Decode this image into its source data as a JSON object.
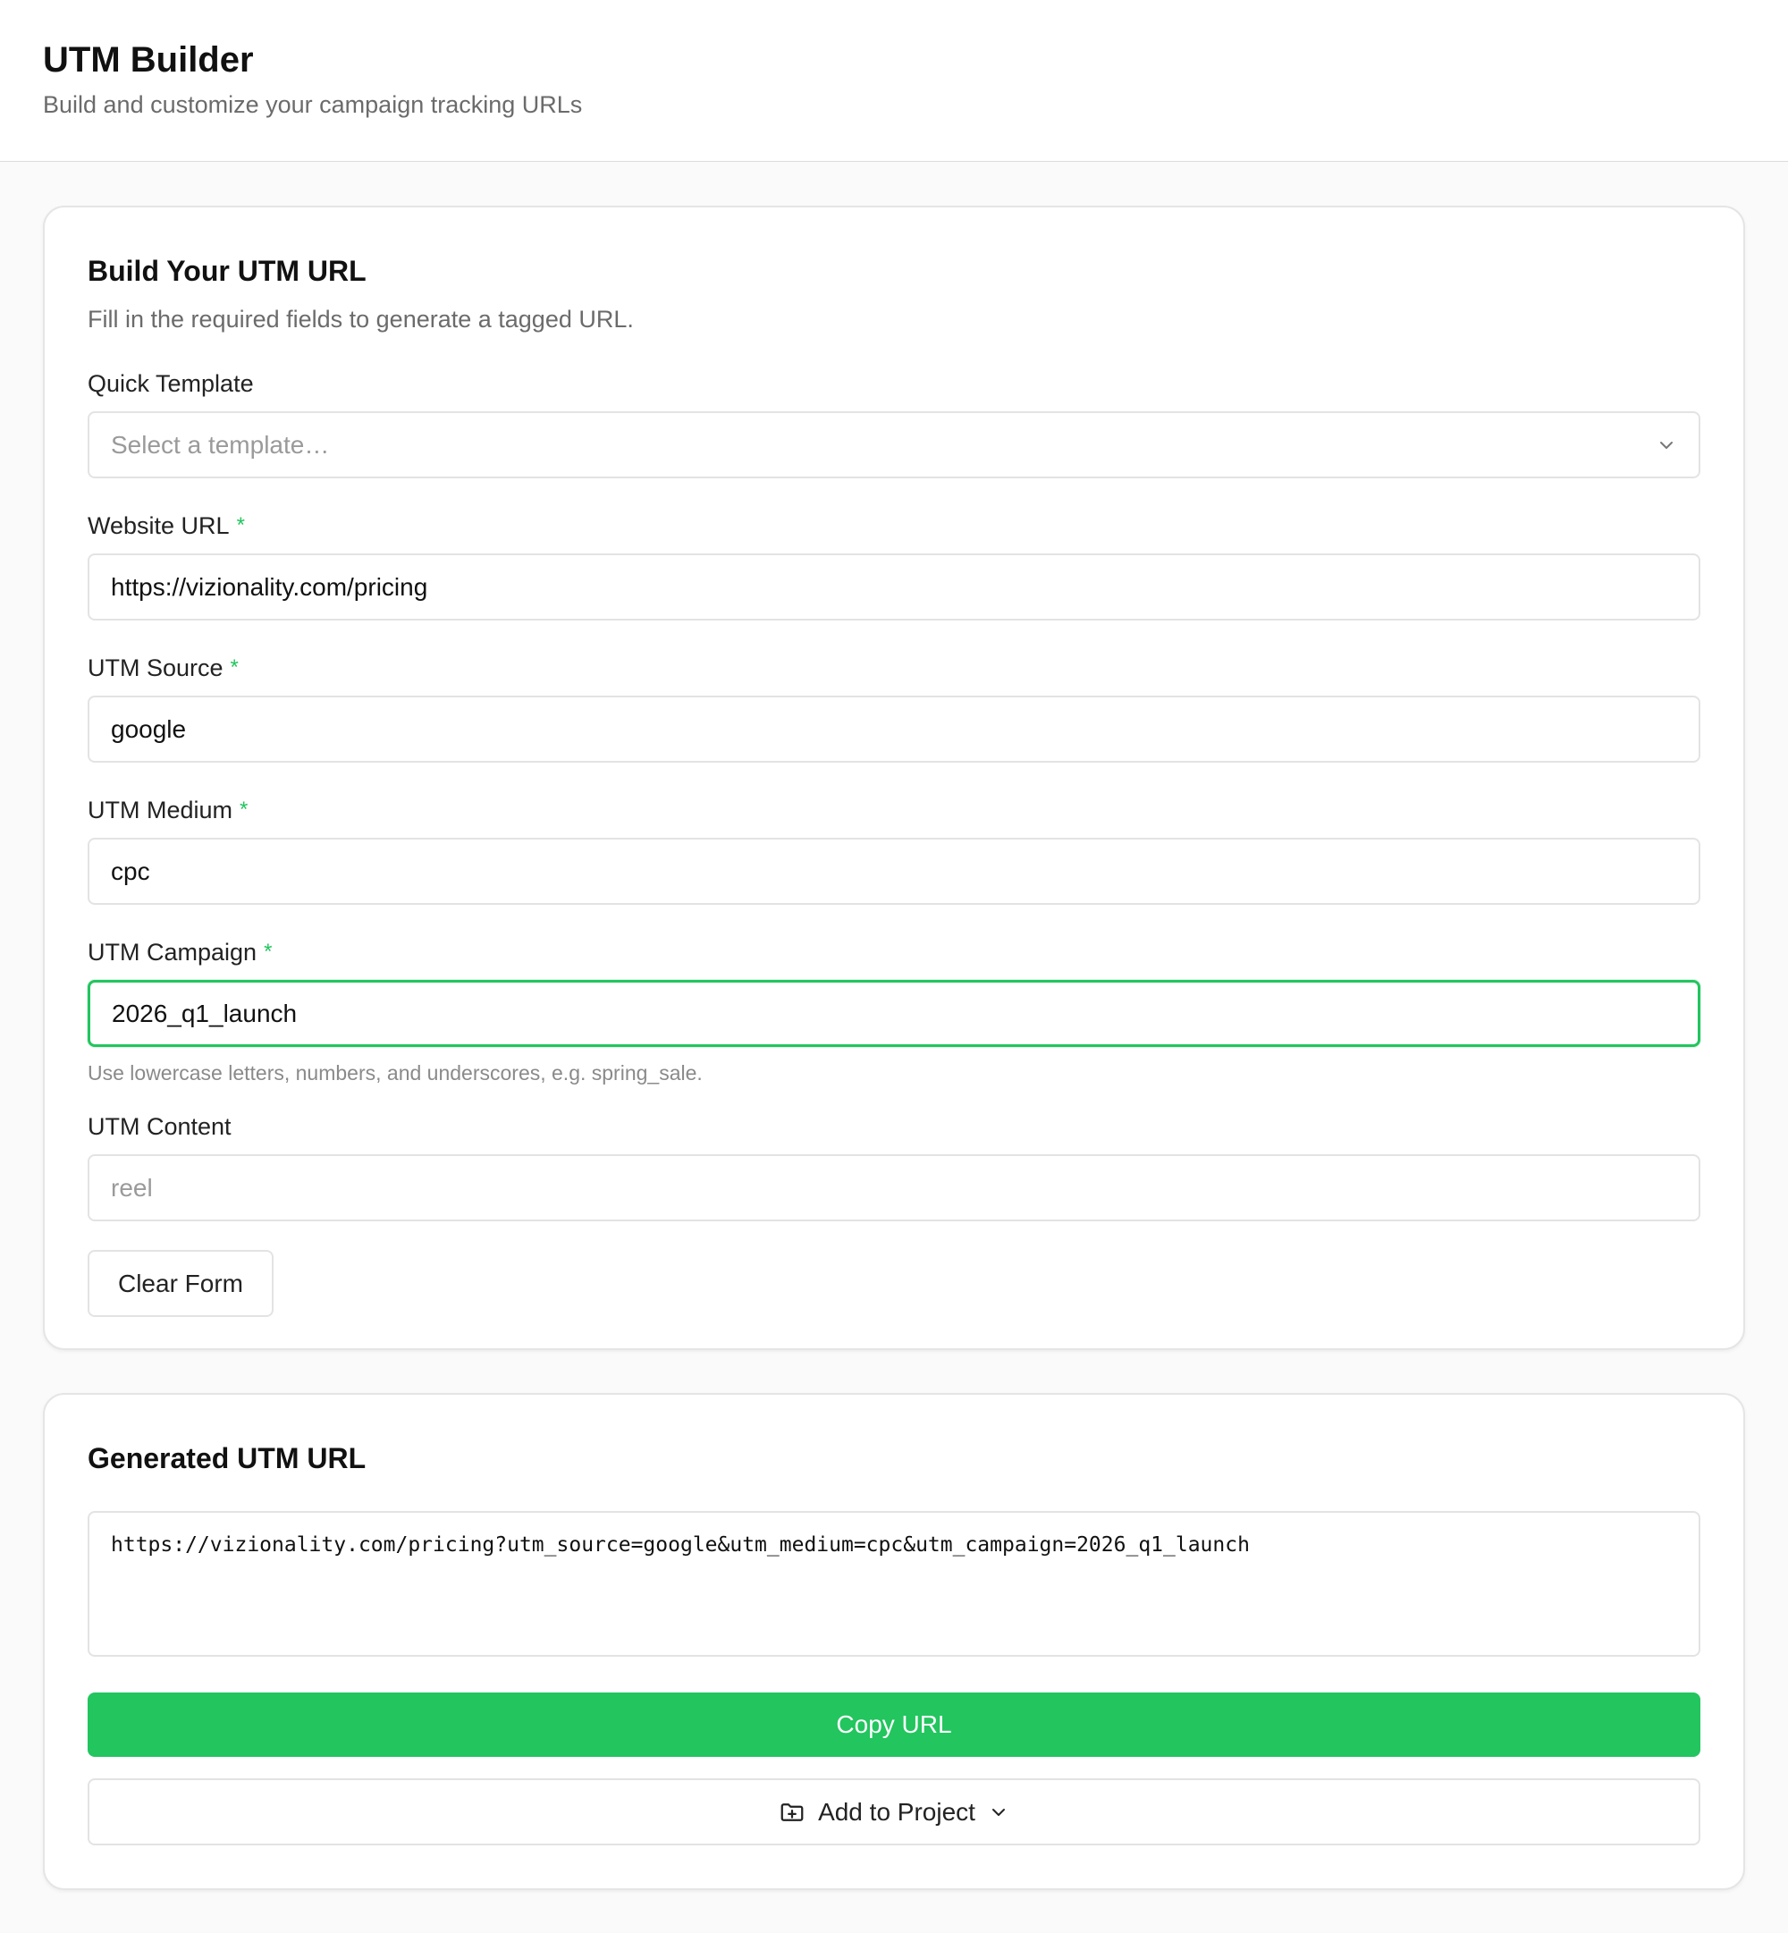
{
  "header": {
    "title": "UTM Builder",
    "subtitle": "Build and customize your campaign tracking URLs"
  },
  "builder": {
    "title": "Build Your UTM URL",
    "description": "Fill in the required fields to generate a tagged URL.",
    "fields": {
      "template": {
        "label": "Quick Template",
        "placeholder": "Select a template…"
      },
      "website_url": {
        "label": "Website URL",
        "required_mark": "*",
        "value": "https://vizionality.com/pricing"
      },
      "utm_source": {
        "label": "UTM Source",
        "required_mark": "*",
        "value": "google"
      },
      "utm_medium": {
        "label": "UTM Medium",
        "required_mark": "*",
        "value": "cpc"
      },
      "utm_campaign": {
        "label": "UTM Campaign",
        "required_mark": "*",
        "value": "2026_q1_launch",
        "hint": "Use lowercase letters, numbers, and underscores, e.g. spring_sale."
      },
      "utm_content": {
        "label": "UTM Content",
        "placeholder": "reel"
      }
    },
    "clear_label": "Clear Form"
  },
  "generated": {
    "title": "Generated UTM URL",
    "url": "https://vizionality.com/pricing?utm_source=google&utm_medium=cpc&utm_campaign=2026_q1_launch",
    "copy_label": "Copy URL",
    "project_label": "Add to Project"
  },
  "colors": {
    "accent": "#22c55e",
    "border": "#e3e3e3",
    "muted_text": "#6b6b6b"
  },
  "icons": {
    "select_chevron": "chevron-down-icon",
    "project_folder": "folder-plus-icon",
    "project_chevron": "chevron-down-icon"
  }
}
